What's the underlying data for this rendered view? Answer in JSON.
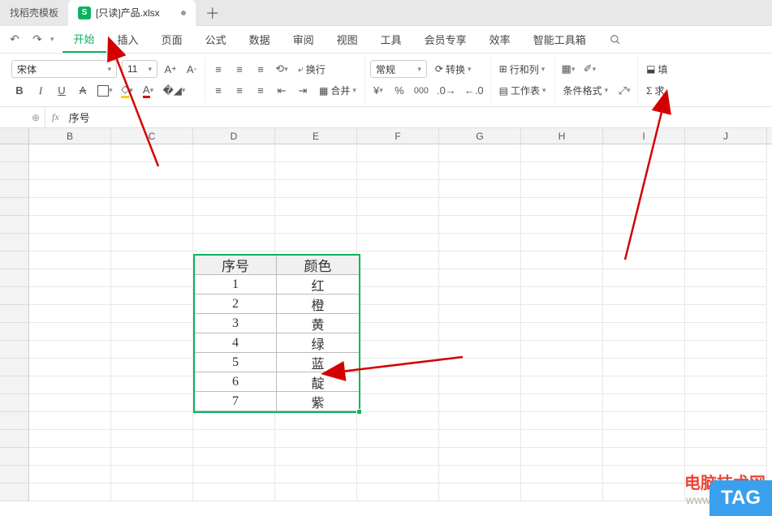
{
  "tabs": {
    "inactive_label": "找稻壳模板",
    "active_label": "[只读]产品.xlsx",
    "icon_letter": "S",
    "plus": "＋"
  },
  "menu": {
    "items": [
      "开始",
      "插入",
      "页面",
      "公式",
      "数据",
      "审阅",
      "视图",
      "工具",
      "会员专享",
      "效率",
      "智能工具箱"
    ],
    "active_index": 0
  },
  "ribbon": {
    "font_name": "宋体",
    "font_size": "11",
    "wrap_label": "换行",
    "merge_label": "合并",
    "numfmt_label": "常规",
    "convert_label": "转换",
    "rowscols_label": "行和列",
    "worksheet_label": "工作表",
    "condfmt_label": "条件格式",
    "fill_label": "填",
    "sum_label": "求"
  },
  "formula_bar": {
    "fx": "fx",
    "value": "序号"
  },
  "columns": [
    "B",
    "C",
    "D",
    "E",
    "F",
    "G",
    "H",
    "I",
    "J"
  ],
  "chart_data": {
    "type": "table",
    "headers": [
      "序号",
      "颜色"
    ],
    "rows": [
      [
        "1",
        "红"
      ],
      [
        "2",
        "橙"
      ],
      [
        "3",
        "黄"
      ],
      [
        "4",
        "绿"
      ],
      [
        "5",
        "蓝"
      ],
      [
        "6",
        "靛"
      ],
      [
        "7",
        "紫"
      ]
    ]
  },
  "watermark": {
    "line1": "电脑技术网",
    "line2": "www.tagxp.com",
    "tag": "TAG"
  },
  "colors": {
    "accent": "#0bb35f",
    "arrow": "#d40000"
  }
}
